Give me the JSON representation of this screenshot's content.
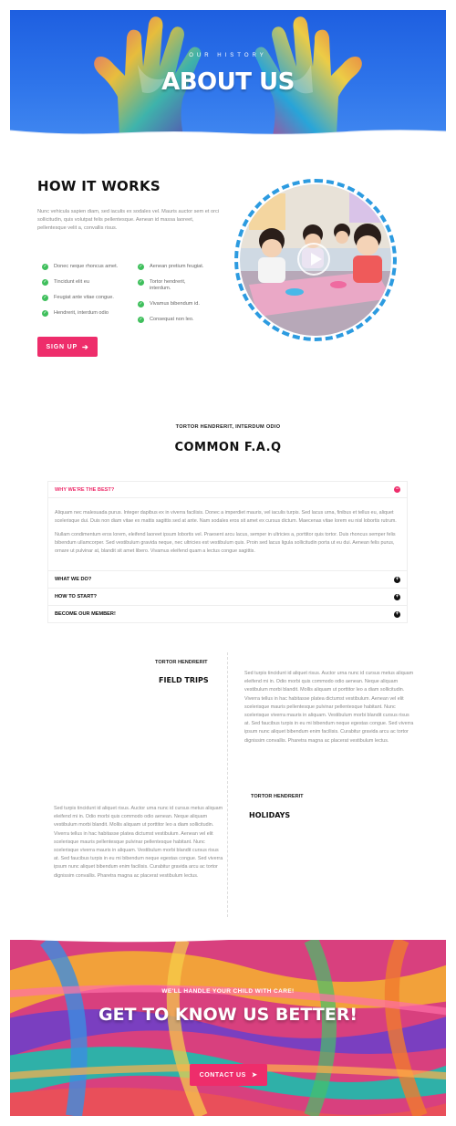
{
  "hero": {
    "eyebrow": "OUR HISTORY",
    "title": "ABOUT US"
  },
  "how": {
    "title": "HOW IT WORKS",
    "description": "Nunc vehicula sapien diam, sed iaculis ex sodales vel. Mauris auctor sem et orci sollicitudin, quis volutpat felis pellentesque. Aenean id massa laoreet, pellentesque velit a, convallis risus.",
    "checks_left": [
      "Donec neque rhoncus amet.",
      "Tincidunt elit eu",
      "Feugiat ante vitae congue.",
      "Hendrerit, interdum odio"
    ],
    "checks_right": [
      "Aenean pretium feugiat.",
      "Tortor hendrerit, interdum.",
      "Vivamus bibendum id.",
      "Consequat non leo."
    ],
    "signup_label": "SIGN UP",
    "video_label": "play-button"
  },
  "faq": {
    "eyebrow": "TORTOR HENDRERIT, INTERDUM ODIO",
    "title": "COMMON F.A.Q",
    "items": [
      {
        "q": "WHY WE'RE THE BEST?",
        "open": true
      },
      {
        "q": "WHAT WE DO?",
        "open": false
      },
      {
        "q": "HOW TO START?",
        "open": false
      },
      {
        "q": "BECOME OUR MEMBER!",
        "open": false
      }
    ],
    "answer_p1": "Aliquam nec malesuada purus. Integer dapibus ex in viverra facilisis. Donec a imperdiet mauris, vel iaculis turpis. Sed lacus urna, finibus et tellus eu, aliquet scelerisque dui. Duis non diam vitae ex mattis sagittis sed at ante. Nam sodales eros sit amet ex cursus dictum. Maecenas vitae lorem eu nisl lobortis rutrum.",
    "answer_p2": "Nullam condimentum eros lorem, eleifend laoreet ipsum lobortis vel. Praesent arcu lacus, semper in ultricies a, porttitor quis tortor. Duis rhoncus semper felis bibendum ullamcorper. Sed vestibulum gravida neque, nec ultricies est vestibulum quis. Proin sed lacus ligula sollicitudin porta ut eu dui. Aenean felis purus, ornare ut pulvinar at, blandit sit amet libero. Vivamus eleifend quam a lectus congue sagittis."
  },
  "timeline": {
    "field_trips": {
      "eyebrow": "TORTOR HENDRERIT",
      "title": "FIELD TRIPS",
      "text": "Sed turpis tincidunt id aliquet risus. Auctor urna nunc id cursus metus aliquam eleifend mi in. Odio morbi quis commodo odio aenean. Neque aliquam vestibulum morbi blandit. Mollis aliquam ut porttitor leo a diam sollicitudin. Viverra tellus in hac habitasse platea dictumst vestibulum. Aenean vel elit scelerisque mauris pellentesque pulvinar pellentesque habitant. Nunc scelerisque viverra mauris in aliquam. Vestibulum morbi blandit cursus risus at. Sed faucibus turpis in eu mi bibendum neque egestas congue. Sed viverra ipsum nunc aliquet bibendum enim facilisis. Curabitur gravida arcu ac tortor dignissim convallis. Pharetra magna ac placerat vestibulum lectus."
    },
    "holidays": {
      "eyebrow": "TORTOR HENDRERIT",
      "title": "HOLIDAYS",
      "text": "Sed turpis tincidunt id aliquet risus. Auctor urna nunc id cursus metus aliquam eleifend mi in. Odio morbi quis commodo odio aenean. Neque aliquam vestibulum morbi blandit. Mollis aliquam ut porttitor leo a diam sollicitudin. Viverra tellus in hac habitasse platea dictumst vestibulum. Aenean vel elit scelerisque mauris pellentesque pulvinar pellentesque habitant. Nunc scelerisque viverra mauris in aliquam. Vestibulum morbi blandit cursus risus at. Sed faucibus turpis in eu mi bibendum neque egestas congue. Sed viverra ipsum nunc aliquet bibendum enim facilisis. Curabitur gravida arcu ac tortor dignissim convallis. Pharetra magna ac placerat vestibulum lectus."
    }
  },
  "cta": {
    "eyebrow": "WE'LL HANDLE YOUR CHILD WITH CARE!",
    "title": "GET TO KNOW US BETTER!",
    "button_label": "CONTACT US"
  },
  "colors": {
    "accent": "#ee2d6b",
    "check_green": "#3fbf5c",
    "ring_blue": "#2c9be0",
    "hero_blue": "#1e5fe0"
  }
}
